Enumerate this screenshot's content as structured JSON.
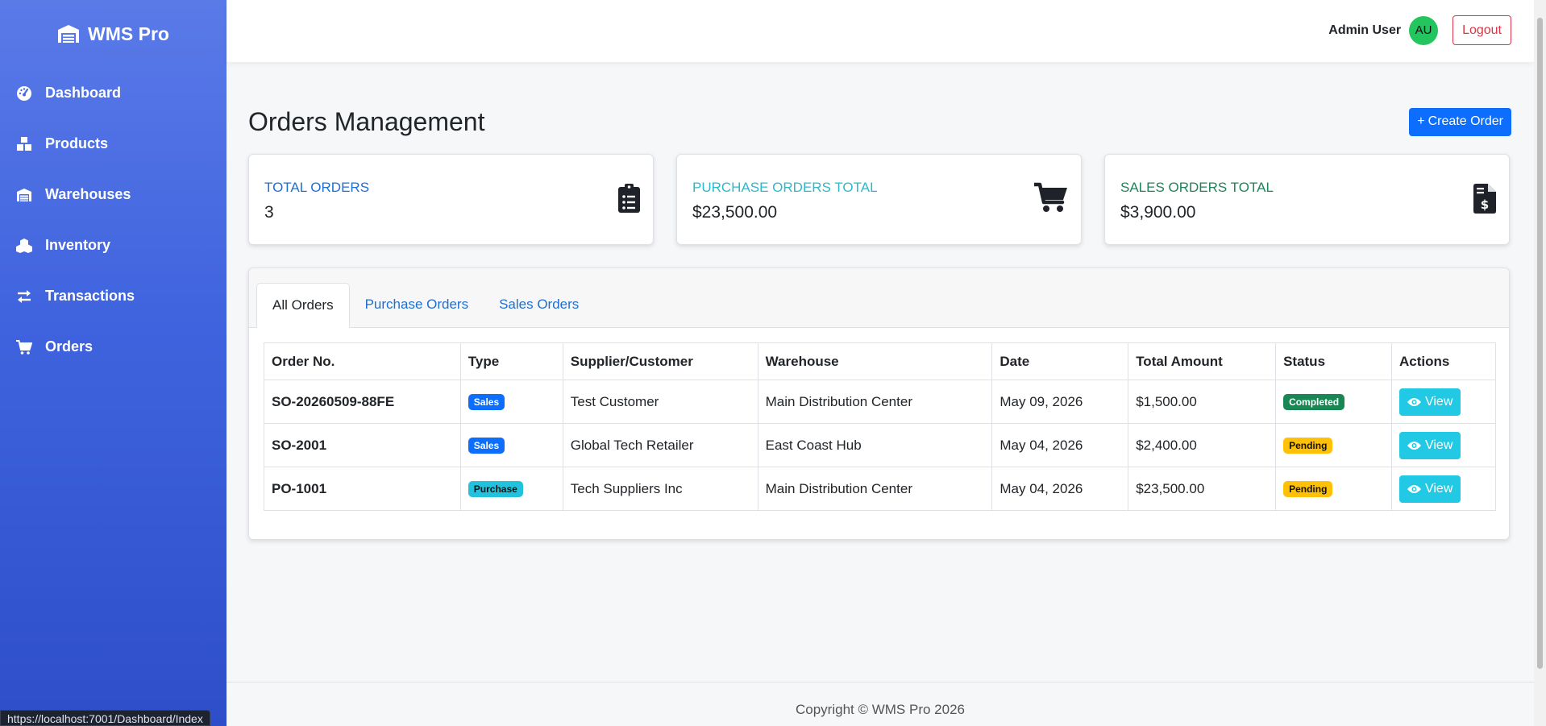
{
  "sidebar": {
    "brand": "WMS Pro",
    "items": [
      {
        "label": "Dashboard"
      },
      {
        "label": "Products"
      },
      {
        "label": "Warehouses"
      },
      {
        "label": "Inventory"
      },
      {
        "label": "Transactions"
      },
      {
        "label": "Orders"
      }
    ]
  },
  "status_url": "https://localhost:7001/Dashboard/Index",
  "topbar": {
    "user_name": "Admin User",
    "avatar_initials": "AU",
    "logout_label": "Logout"
  },
  "page": {
    "title": "Orders Management",
    "create_label": "Create Order"
  },
  "stats": [
    {
      "label": "TOTAL ORDERS",
      "value": "3",
      "color": "#1f6fd1",
      "icon": "clipboard-list-icon"
    },
    {
      "label": "PURCHASE ORDERS TOTAL",
      "value": "$23,500.00",
      "color": "#2eb8cc",
      "icon": "shopping-cart-icon"
    },
    {
      "label": "SALES ORDERS TOTAL",
      "value": "$3,900.00",
      "color": "#22825a",
      "icon": "file-invoice-dollar-icon"
    }
  ],
  "tabs": [
    {
      "label": "All Orders",
      "active": true
    },
    {
      "label": "Purchase Orders",
      "active": false
    },
    {
      "label": "Sales Orders",
      "active": false
    }
  ],
  "table": {
    "headers": [
      "Order No.",
      "Type",
      "Supplier/Customer",
      "Warehouse",
      "Date",
      "Total Amount",
      "Status",
      "Actions"
    ],
    "rows": [
      {
        "order_no": "SO-20260509-88FE",
        "type": "Sales",
        "party": "Test Customer",
        "warehouse": "Main Distribution Center",
        "date": "May 09, 2026",
        "total": "$1,500.00",
        "status": "Completed",
        "action": "View"
      },
      {
        "order_no": "SO-2001",
        "type": "Sales",
        "party": "Global Tech Retailer",
        "warehouse": "East Coast Hub",
        "date": "May 04, 2026",
        "total": "$2,400.00",
        "status": "Pending",
        "action": "View"
      },
      {
        "order_no": "PO-1001",
        "type": "Purchase",
        "party": "Tech Suppliers Inc",
        "warehouse": "Main Distribution Center",
        "date": "May 04, 2026",
        "total": "$23,500.00",
        "status": "Pending",
        "action": "View"
      }
    ]
  },
  "footer": {
    "copyright": "Copyright © WMS Pro 2026"
  }
}
